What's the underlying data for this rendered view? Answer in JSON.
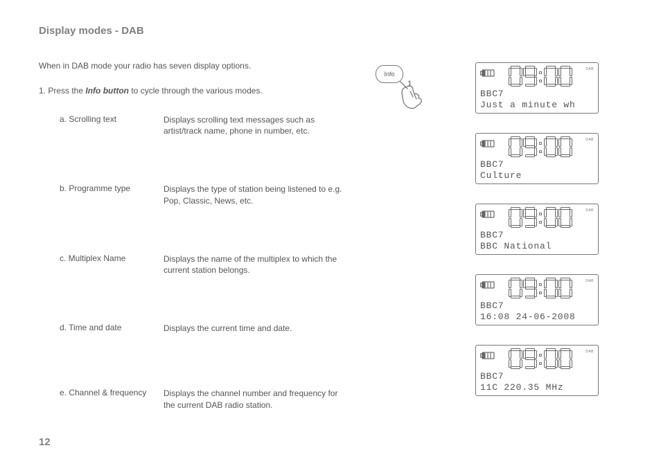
{
  "title": "Display modes - DAB",
  "intro": "When in DAB mode your radio has seven display options.",
  "step1_prefix": "1.   Press the ",
  "step1_bold": "Info button",
  "step1_suffix": " to cycle through the various modes.",
  "modes": [
    {
      "label": "a. Scrolling text",
      "desc": "Displays scrolling text messages such as artist/track name, phone in number, etc."
    },
    {
      "label": "b. Programme type",
      "desc": "Displays the type of station being listened to e.g. Pop, Classic, News, etc."
    },
    {
      "label": "c. Multiplex Name",
      "desc": "Displays the name of the multiplex to which the current station belongs."
    },
    {
      "label": "d. Time and date",
      "desc": "Displays the current time and date."
    },
    {
      "label": "e. Channel & frequency",
      "desc": "Displays the channel number and frequency for the current DAB radio station."
    }
  ],
  "info_button": {
    "label": "Info",
    "callout": "1"
  },
  "lcd": {
    "clock": "09:00",
    "dab_label": "DAB",
    "station": "BBC7",
    "lines": [
      "Just a minute wh",
      "Culture",
      "BBC National",
      "16:08 24-06-2008",
      "11C   220.35 MHz"
    ]
  },
  "page_number": "12"
}
